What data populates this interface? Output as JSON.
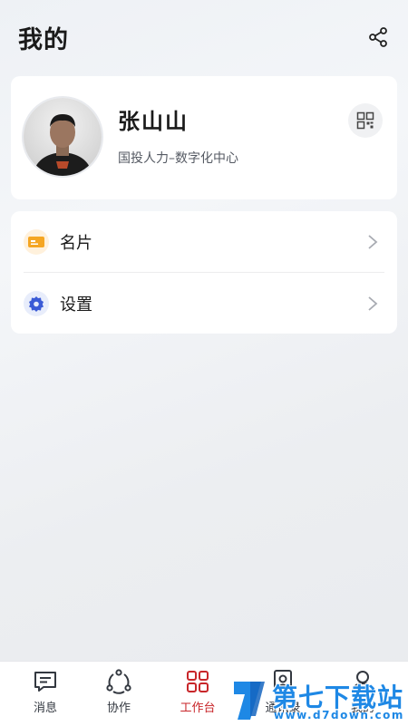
{
  "header": {
    "title": "我的",
    "share_icon": "share-icon"
  },
  "profile": {
    "name": "张山山",
    "organization": "国投人力–数字化中心",
    "avatar_icon": "user-photo-avatar",
    "qr_icon": "qr-code-icon"
  },
  "menu": {
    "items": [
      {
        "label": "名片",
        "icon": "business-card-icon",
        "icon_color": "#f5a623"
      },
      {
        "label": "设置",
        "icon": "gear-icon",
        "icon_color": "#3b5bd6"
      }
    ]
  },
  "tabbar": {
    "active_color": "#c8262a",
    "tabs": [
      {
        "label": "消息",
        "icon": "message-icon",
        "active": false
      },
      {
        "label": "协作",
        "icon": "collaboration-icon",
        "active": false
      },
      {
        "label": "工作台",
        "icon": "workbench-icon",
        "active": true
      },
      {
        "label": "通讯录",
        "icon": "contacts-icon",
        "active": false
      },
      {
        "label": "我的",
        "icon": "profile-icon",
        "active": false
      }
    ]
  },
  "watermark": {
    "text": "第七下载站",
    "url": "www.d7down.com",
    "color": "#1e88e5"
  }
}
